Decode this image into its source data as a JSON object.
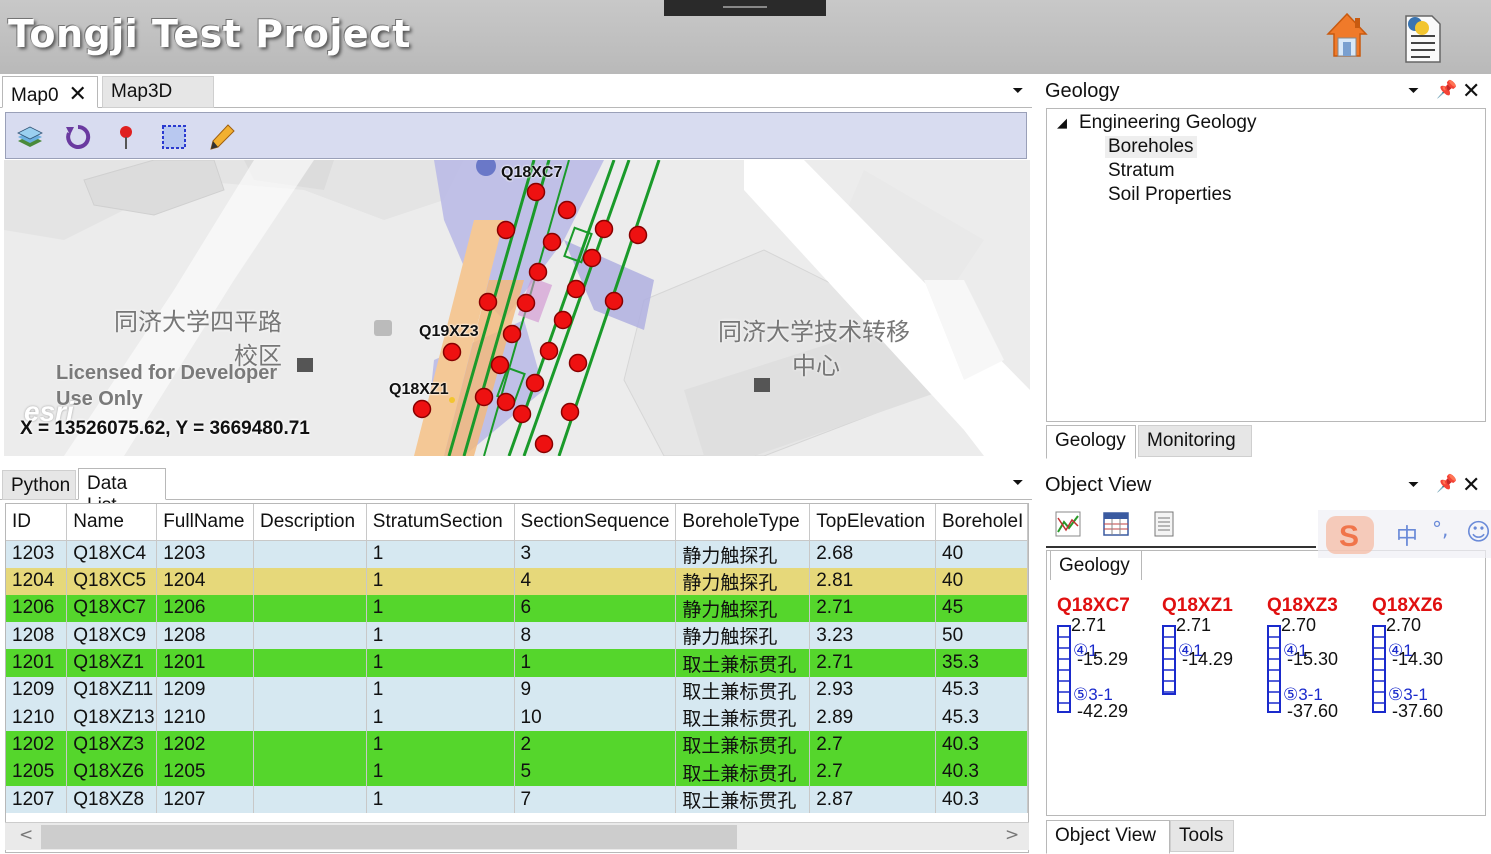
{
  "app": {
    "title": "Tongji Test Project"
  },
  "map_panel": {
    "tabs": [
      {
        "label": "Map0",
        "active": true
      },
      {
        "label": "Map3D",
        "active": false
      }
    ],
    "toolbar_icons": [
      "layers-icon",
      "refresh-icon",
      "pin-icon",
      "select-rect-icon",
      "pencil-icon"
    ],
    "labels": {
      "xc7": "Q18XC7",
      "xz3": "Q19XZ3",
      "xz1": "Q18XZ1"
    },
    "places": {
      "left_1": "同济大学四平路",
      "left_2": "校区",
      "right_1": "同济大学技术转移",
      "right_2": "中心"
    },
    "license_1": "Licensed for Developer",
    "license_2": "Use Only",
    "esri": "esri",
    "coords": "X = 13526075.62, Y = 3669480.71"
  },
  "data_panel": {
    "tabs": [
      {
        "label": "Python",
        "active": false
      },
      {
        "label": "Data List",
        "active": true
      }
    ],
    "columns": [
      "ID",
      "Name",
      "FullName",
      "Description",
      "StratumSection",
      "SectionSequence",
      "BoreholeType",
      "TopElevation",
      "BoreholeI"
    ],
    "rows": [
      {
        "style": "normal",
        "cells": [
          "1203",
          "Q18XC4",
          "1203",
          "",
          "1",
          "3",
          "静力触探孔",
          "2.68",
          "40"
        ]
      },
      {
        "style": "selected",
        "cells": [
          "1204",
          "Q18XC5",
          "1204",
          "",
          "1",
          "4",
          "静力触探孔",
          "2.81",
          "40"
        ]
      },
      {
        "style": "green",
        "cells": [
          "1206",
          "Q18XC7",
          "1206",
          "",
          "1",
          "6",
          "静力触探孔",
          "2.71",
          "45"
        ]
      },
      {
        "style": "normal",
        "cells": [
          "1208",
          "Q18XC9",
          "1208",
          "",
          "1",
          "8",
          "静力触探孔",
          "3.23",
          "50"
        ]
      },
      {
        "style": "green",
        "cells": [
          "1201",
          "Q18XZ1",
          "1201",
          "",
          "1",
          "1",
          "取土兼标贯孔",
          "2.71",
          "35.3"
        ]
      },
      {
        "style": "normal",
        "cells": [
          "1209",
          "Q18XZ11",
          "1209",
          "",
          "1",
          "9",
          "取土兼标贯孔",
          "2.93",
          "45.3"
        ]
      },
      {
        "style": "normal",
        "cells": [
          "1210",
          "Q18XZ13",
          "1210",
          "",
          "1",
          "10",
          "取土兼标贯孔",
          "2.89",
          "45.3"
        ]
      },
      {
        "style": "green",
        "cells": [
          "1202",
          "Q18XZ3",
          "1202",
          "",
          "1",
          "2",
          "取土兼标贯孔",
          "2.7",
          "40.3"
        ]
      },
      {
        "style": "green",
        "cells": [
          "1205",
          "Q18XZ6",
          "1205",
          "",
          "1",
          "5",
          "取土兼标贯孔",
          "2.7",
          "40.3"
        ]
      },
      {
        "style": "normal",
        "cells": [
          "1207",
          "Q18XZ8",
          "1207",
          "",
          "1",
          "7",
          "取土兼标贯孔",
          "2.87",
          "40.3"
        ]
      }
    ],
    "scroll_left": "<",
    "scroll_right": ">"
  },
  "geology_panel": {
    "title": "Geology",
    "tree": {
      "root": "Engineering Geology",
      "children": [
        "Boreholes",
        "Stratum",
        "Soil Properties"
      ]
    },
    "bottom_tabs": [
      {
        "label": "Geology",
        "active": true
      },
      {
        "label": "Monitoring",
        "active": false
      }
    ]
  },
  "object_view_panel": {
    "title": "Object View",
    "inner_tab": "Geology",
    "boreholes": [
      {
        "name": "Q18XC7",
        "top": "2.71",
        "l1": "④1",
        "mid": "-15.29",
        "l2": "⑤3-1",
        "bottom": "-42.29"
      },
      {
        "name": "Q18XZ1",
        "top": "2.71",
        "l1": "④1",
        "mid": "-14.29",
        "l2": "",
        "bottom": ""
      },
      {
        "name": "Q18XZ3",
        "top": "2.70",
        "l1": "④1",
        "mid": "-15.30",
        "l2": "⑤3-1",
        "bottom": "-37.60"
      },
      {
        "name": "Q18XZ6",
        "top": "2.70",
        "l1": "④1",
        "mid": "-14.30",
        "l2": "⑤3-1",
        "bottom": "-37.60"
      }
    ],
    "bottom_tabs": [
      {
        "label": "Object View",
        "active": true
      },
      {
        "label": "Tools",
        "active": false
      }
    ]
  },
  "ime": {
    "zh": "中",
    "punct": "°,"
  }
}
